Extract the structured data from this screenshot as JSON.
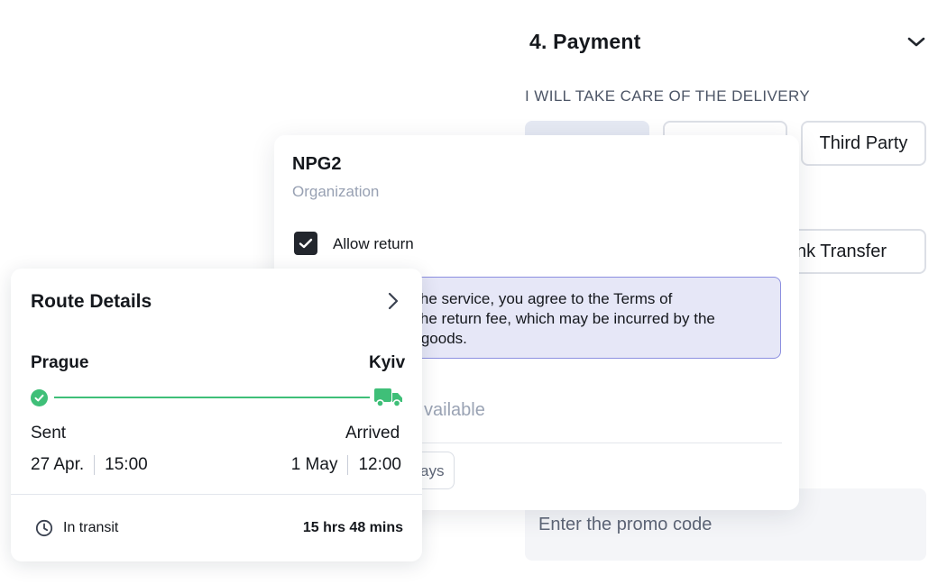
{
  "payment": {
    "title": "4. Payment",
    "subtitle": "I WILL TAKE CARE OF THE DELIVERY",
    "options": [
      {
        "label": ""
      },
      {
        "label": ""
      },
      {
        "label": "Third Party"
      },
      {
        "label": "nk Transfer"
      }
    ],
    "promo_placeholder": "Enter the promo code"
  },
  "organization": {
    "name": "NPG2",
    "type": "Organization",
    "allow_return": {
      "label": "Allow return",
      "checked": true
    },
    "terms_lines": [
      "n the service, you agree to the Terms of",
      "d the return fee, which may be incurred by the",
      "ur goods."
    ],
    "availability": "vailable",
    "days_chip": "ays"
  },
  "route": {
    "title": "Route Details",
    "from": "Prague",
    "to": "Kyiv",
    "sent_label": "Sent",
    "arrived_label": "Arrived",
    "sent_date": "27 Apr.",
    "sent_time": "15:00",
    "arrived_date": "1 May",
    "arrived_time": "12:00",
    "status": "In transit",
    "duration": "15 hrs 48 mins"
  },
  "colors": {
    "accent_green": "#3fbf78",
    "terms_bg": "#e6e7f7",
    "terms_border": "#8c8fe0"
  }
}
